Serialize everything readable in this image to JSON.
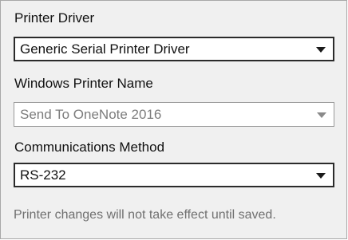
{
  "printer_driver": {
    "label": "Printer Driver",
    "selected": "Generic Serial Printer Driver",
    "enabled": true
  },
  "windows_printer_name": {
    "label": "Windows Printer Name",
    "selected": "Send To OneNote 2016",
    "enabled": false
  },
  "communications_method": {
    "label": "Communications Method",
    "selected": "RS-232",
    "enabled": true
  },
  "notice": "Printer changes will not take effect until saved.",
  "icons": {
    "dropdown": "chevron-down-icon"
  },
  "colors": {
    "panel_background": "#f0f0f0",
    "disabled_text": "#7c7c7c",
    "notice_text": "#707070"
  }
}
